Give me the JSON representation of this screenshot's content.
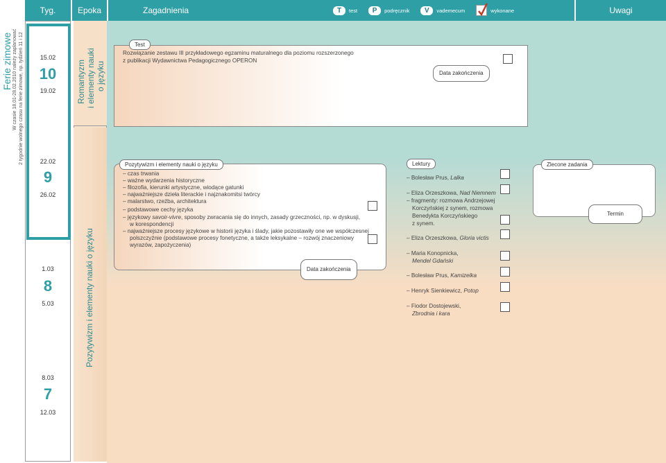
{
  "header": {
    "tyg": "Tyg.",
    "epoka": "Epoka",
    "zagadnienia": "Zagadnienia",
    "uwagi": "Uwagi",
    "legend": [
      {
        "badge": "T",
        "label": "test"
      },
      {
        "badge": "P",
        "label": "podręcznik"
      },
      {
        "badge": "V",
        "label": "vademecum"
      },
      {
        "badge": "check",
        "label": "wykonane"
      }
    ]
  },
  "ferie": {
    "title": "Ferie zimowe",
    "note1": "W czasie 18.01-28.02.2010 należy zaplanować",
    "note2": "2 tygodnie wolnego czasu na ferie zimowe, np. tydzień 11 i 12"
  },
  "weeks": [
    {
      "start": "15.02",
      "num": "10",
      "end": "19.02"
    },
    {
      "start": "22.02",
      "num": "9",
      "end": "26.02"
    },
    {
      "start": "1.03",
      "num": "8",
      "end": "5.03"
    },
    {
      "start": "8.03",
      "num": "7",
      "end": "12.03"
    }
  ],
  "epoka": {
    "romantyzm": [
      "Romantyzm",
      "i elementy nauki",
      "o języku"
    ],
    "pozytywizm": "Pozytywizm i elementy nauki o języku"
  },
  "test_block": {
    "tag": "Test",
    "line1": "Rozwiązanie zestawu III przykładowego egzaminu maturalnego dla poziomu rozszerzonego",
    "line2": "z publikacji Wydawnictwa Pedagogicznego OPERON",
    "deadline": "Data zakończenia"
  },
  "topics_block": {
    "tag": "Pozytywizm i elementy nauki o języku",
    "lines": [
      "– czas trwania",
      "– ważne wydarzenia historyczne",
      "– filozofia, kierunki artystyczne, wiodące gatunki",
      "– najważniejsze dzieła literackie i najznakomitsi twórcy",
      "– malarstwo, rzeźba, architektura",
      "– podstawowe cechy języka",
      "– językowy",
      "savoir-vivre",
      ", sposoby zwracania się do innych, zasady grzeczności, np. w dyskusji,",
      "w korespondencji",
      "– najważniejsze procesy językowe w historii języka i ślady, jakie pozostawiły one we współczesnej",
      "polszczyźnie (podstawowe procesy fonetyczne, a także leksykalne – rozwój znaczeniowy",
      "wyrazów, zapożyczenia)"
    ],
    "deadline": "Data zakończenia"
  },
  "lektury": {
    "tag": "Lektury",
    "items": [
      {
        "author": "– Bolesław Prus,",
        "title": "Lalka"
      },
      {
        "author": "– Eliza Orzeszkowa,",
        "title": "Nad Niemnem"
      },
      {
        "sub": [
          "– fragmenty: rozmowa Andrzejowej",
          "Korczyńskiej z synem, rozmowa",
          "Benedykta Korczyńskiego",
          "z synem."
        ]
      },
      {
        "author": "– Eliza Orzeszkowa,",
        "title": "Gloria victis"
      },
      {
        "author": "– Maria Konopnicka,",
        "title": "Mendel Gdański"
      },
      {
        "author": "– Bolesław Prus,",
        "title": "Kamizelka"
      },
      {
        "author": "– Henryk Sienkiewicz,",
        "title": "Potop"
      },
      {
        "author": "– Fiodor Dostojewski,",
        "title": "Zbrodnia i kara"
      }
    ]
  },
  "zlecone": {
    "tag": "Zlecone zadania",
    "termin": "Termin"
  },
  "colors": {
    "teal": "#2f9fa6",
    "mint": "#b5dbd5",
    "peach": "#f9ddc3"
  }
}
